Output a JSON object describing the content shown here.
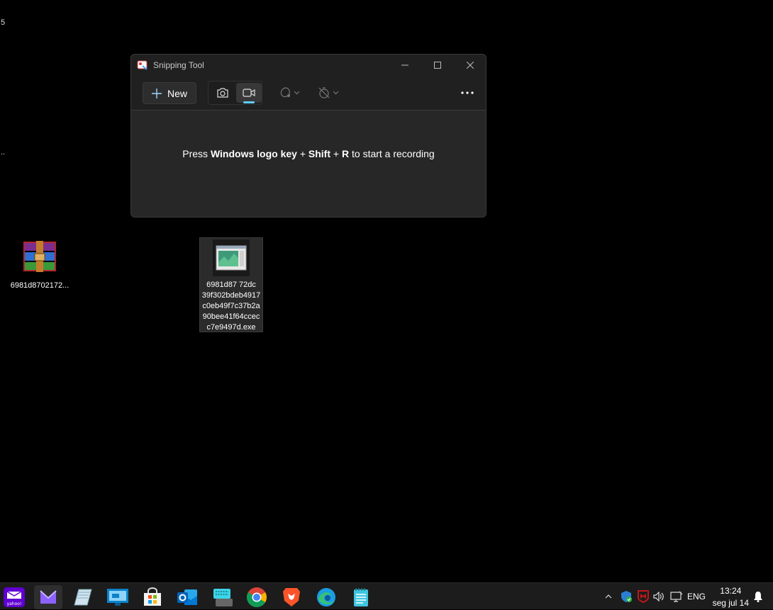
{
  "desktop": {
    "edge_text_1": "5",
    "edge_text_2": "..",
    "icons": [
      {
        "label": "6981d8702172..."
      },
      {
        "label_lines": [
          "6981d87  72dc",
          "39f302bdeb4917",
          "c0eb49f7c37b2a",
          "90bee41f64ccec",
          "c7e9497d.exe"
        ]
      }
    ]
  },
  "window": {
    "title": "Snipping Tool",
    "new_label": "New",
    "hint": {
      "prefix": "Press ",
      "keys1": "Windows logo key",
      "plus1": " + ",
      "keys2": "Shift",
      "plus2": " + ",
      "keys3": "R",
      "suffix": " to start a recording"
    }
  },
  "taskbar": {
    "apps": [
      "yahoo-mail",
      "mail",
      "notepad-pen",
      "remote-desktop",
      "microsoft-store",
      "outlook",
      "touch-keyboard",
      "chrome",
      "brave",
      "edge",
      "notepad"
    ],
    "yahoo_text": "yahoo!",
    "language": "ENG",
    "time": "13:24",
    "date": "seg jul 14"
  },
  "colors": {
    "accent": "#60cdff",
    "window_bg": "#202020",
    "content_bg": "#272727"
  }
}
